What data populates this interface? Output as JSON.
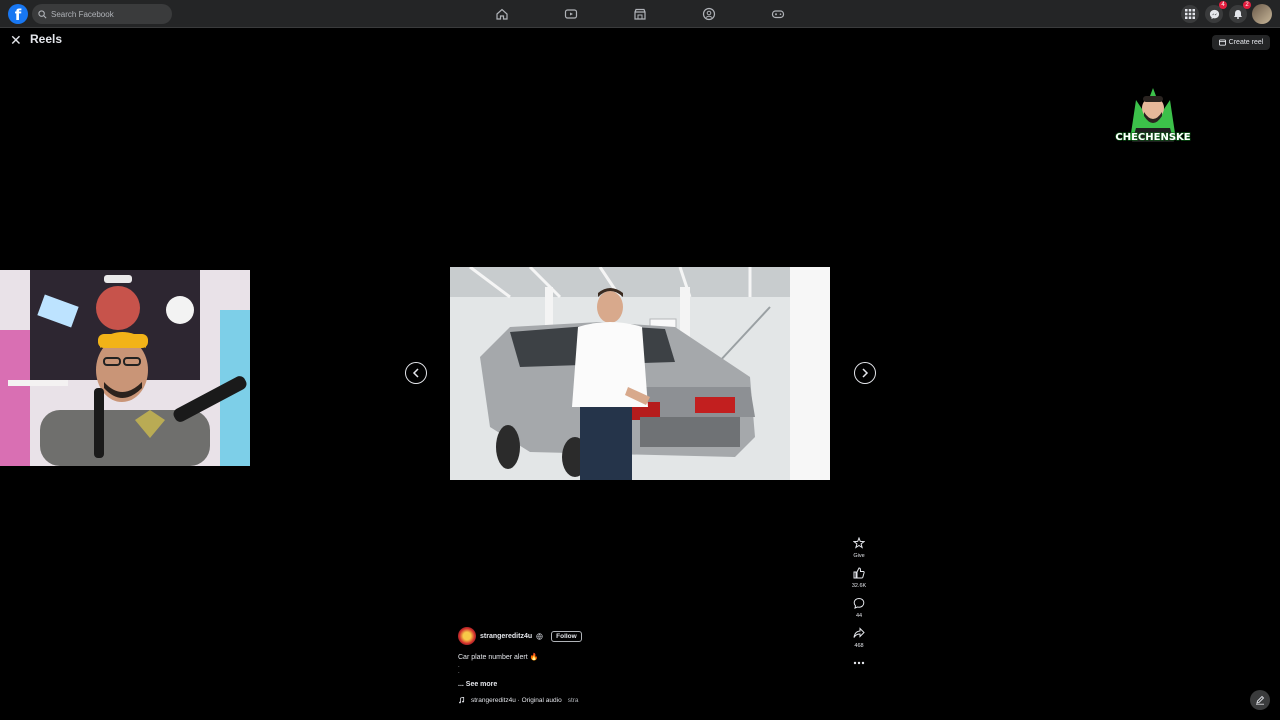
{
  "topbar": {
    "logo_letter": "f",
    "search_placeholder": "Search Facebook",
    "nav_icons": [
      "home-icon",
      "video-icon",
      "marketplace-icon",
      "groups-icon",
      "gaming-icon"
    ],
    "right_icons": [
      "menu-grid-icon",
      "messenger-icon",
      "notifications-icon"
    ],
    "messenger_badge": "4",
    "notifications_badge": "2"
  },
  "page": {
    "title": "Reels",
    "close_icon": "close-icon",
    "create_reel_label": "Create reel"
  },
  "watermark": {
    "text": "CHECHENSKE"
  },
  "reel": {
    "author": "strangereditz4u",
    "follow_label": "Follow",
    "caption": "Car plate number alert 🔥",
    "caption_dots": ".\n.",
    "see_more": "... See more",
    "audio_text": "strangereditz4u · Original audio",
    "audio_trailing": "stra"
  },
  "actions": [
    {
      "icon": "gift-icon",
      "label": "Give"
    },
    {
      "icon": "like-icon",
      "label": "32.6K"
    },
    {
      "icon": "comment-icon",
      "label": "44"
    },
    {
      "icon": "share-icon",
      "label": "468"
    },
    {
      "icon": "more-icon",
      "label": ""
    }
  ],
  "colors": {
    "background": "#000000",
    "topbar": "#242526",
    "brand": "#1877f2",
    "badge": "#e41e3f"
  }
}
